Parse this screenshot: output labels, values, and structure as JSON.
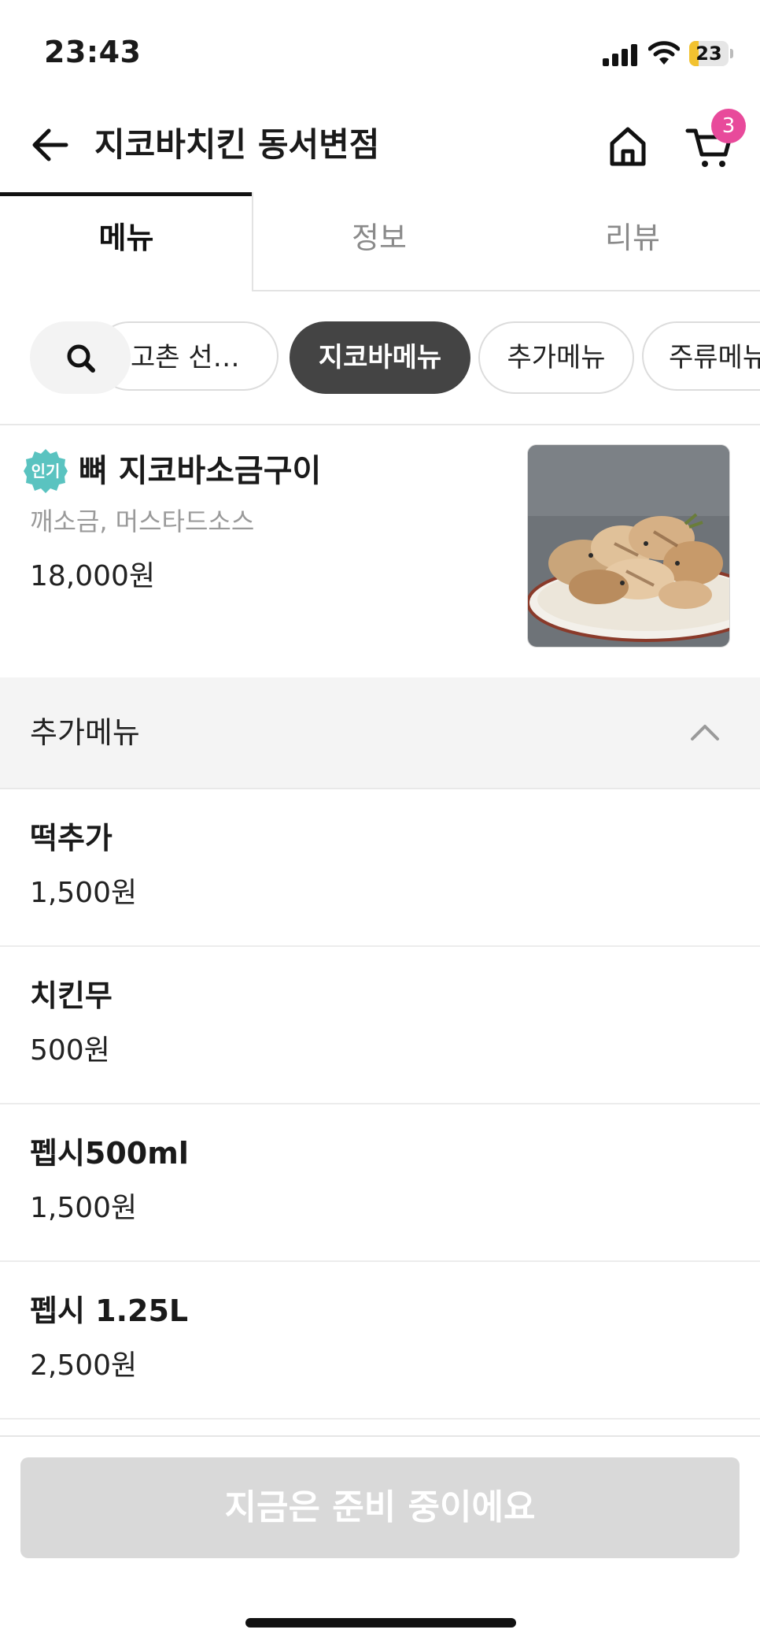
{
  "status_bar": {
    "time": "23:43",
    "battery_level": "23",
    "battery_fraction": 0.23
  },
  "header": {
    "title": "지코바치킨 동서변점",
    "cart_count": "3",
    "back_icon": "arrow-left-icon",
    "home_icon": "home-icon",
    "cart_icon": "cart-icon"
  },
  "tabs": [
    {
      "label": "메뉴",
      "active": true
    },
    {
      "label": "정보",
      "active": false
    },
    {
      "label": "리뷰",
      "active": false
    }
  ],
  "chips": [
    {
      "label": "고촌 선…",
      "active": false
    },
    {
      "label": "지코바메뉴",
      "active": true
    },
    {
      "label": "추가메뉴",
      "active": false
    },
    {
      "label": "주류메뉴",
      "active": false
    }
  ],
  "featured_item": {
    "badge": "인기",
    "name": "뼈 지코바소금구이",
    "description": "깨소금, 머스타드소스",
    "price": "18,000원"
  },
  "section": {
    "title": "추가메뉴",
    "expanded": true
  },
  "menu_items": [
    {
      "name": "떡추가",
      "price": "1,500원"
    },
    {
      "name": "치킨무",
      "price": "500원"
    },
    {
      "name": "펩시500ml",
      "price": "1,500원"
    },
    {
      "name": "펩시 1.25L",
      "price": "2,500원"
    }
  ],
  "order_button": {
    "label": "지금은 준비 중이에요",
    "enabled": false
  },
  "colors": {
    "badge_pink": "#e84a9b",
    "popular_teal": "#5ac3c0",
    "active_chip": "#444444",
    "disabled_button": "#d9d9d9"
  }
}
